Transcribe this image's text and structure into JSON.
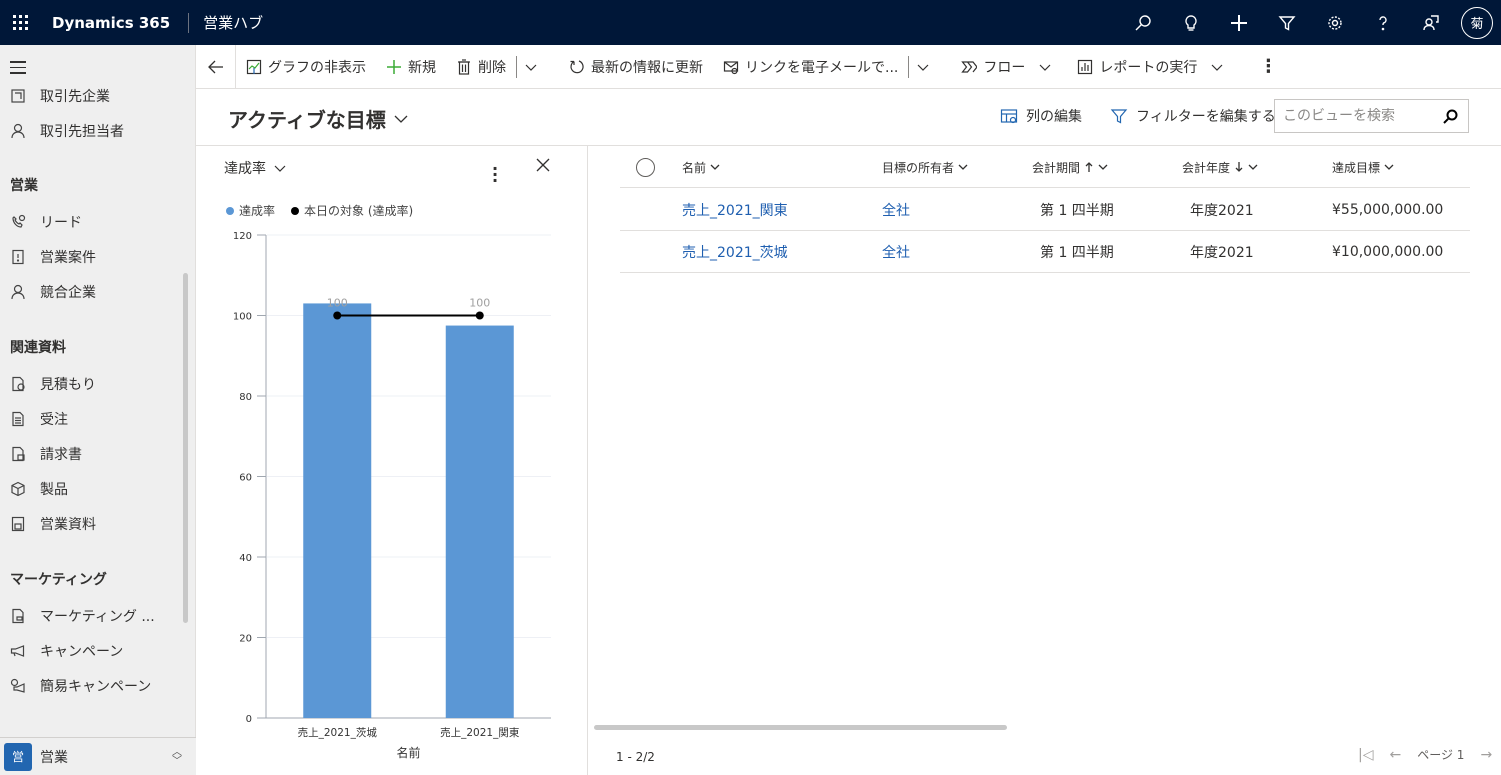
{
  "topbar": {
    "brand": "Dynamics 365",
    "app_name": "営業ハブ",
    "avatar_initial": "菊",
    "icons": [
      "search-icon",
      "lightbulb-icon",
      "plus-icon",
      "filter-icon",
      "gear-icon",
      "help-icon",
      "feedback-icon"
    ]
  },
  "sidebar": {
    "items_top": [
      {
        "label": "取引先企業",
        "icon": "account-icon"
      },
      {
        "label": "取引先担当者",
        "icon": "contact-icon"
      }
    ],
    "groups": [
      {
        "title": "営業",
        "items": [
          {
            "label": "リード",
            "icon": "lead-icon"
          },
          {
            "label": "営業案件",
            "icon": "opportunity-icon"
          },
          {
            "label": "競合企業",
            "icon": "competitor-icon"
          }
        ]
      },
      {
        "title": "関連資料",
        "items": [
          {
            "label": "見積もり",
            "icon": "quote-icon"
          },
          {
            "label": "受注",
            "icon": "order-icon"
          },
          {
            "label": "請求書",
            "icon": "invoice-icon"
          },
          {
            "label": "製品",
            "icon": "product-icon"
          },
          {
            "label": "営業資料",
            "icon": "sales-literature-icon"
          }
        ]
      },
      {
        "title": "マーケティング",
        "items": [
          {
            "label": "マーケティング ...",
            "icon": "marketing-list-icon"
          },
          {
            "label": "キャンペーン",
            "icon": "campaign-icon"
          },
          {
            "label": "簡易キャンペーン",
            "icon": "quick-campaign-icon"
          }
        ]
      }
    ],
    "area": {
      "badge": "営",
      "label": "営業"
    }
  },
  "commandbar": {
    "hide_chart": "グラフの非表示",
    "new": "新規",
    "delete": "削除",
    "refresh": "最新の情報に更新",
    "email_link": "リンクを電子メールで...",
    "flow": "フロー",
    "run_report": "レポートの実行"
  },
  "view": {
    "title": "アクティブな目標",
    "edit_columns": "列の編集",
    "edit_filters": "フィルターを編集する",
    "search_placeholder": "このビューを検索"
  },
  "chart_panel": {
    "title": "達成率",
    "legend": [
      {
        "label": "達成率",
        "color": "#5b97d5"
      },
      {
        "label": "本日の対象 (達成率)",
        "color": "#000000"
      }
    ]
  },
  "chart_data": {
    "type": "bar",
    "title": "達成率",
    "xlabel": "名前",
    "ylabel": "",
    "categories": [
      "売上_2021_茨城",
      "売上_2021_関東"
    ],
    "series": [
      {
        "name": "達成率",
        "type": "bar",
        "color": "#5b97d5",
        "values": [
          103,
          97.5
        ]
      },
      {
        "name": "本日の対象 (達成率)",
        "type": "line",
        "color": "#000000",
        "values": [
          100,
          100
        ],
        "data_labels": [
          "100",
          "100"
        ]
      }
    ],
    "ylim": [
      0,
      120
    ],
    "yticks": [
      0,
      20,
      40,
      60,
      80,
      100,
      120
    ],
    "grid": true,
    "legend": "top-left"
  },
  "grid": {
    "columns": [
      {
        "label": "名前",
        "sort": ""
      },
      {
        "label": "目標の所有者",
        "sort": ""
      },
      {
        "label": "会計期間",
        "sort": "asc"
      },
      {
        "label": "会計年度",
        "sort": "desc"
      },
      {
        "label": "達成目標",
        "sort": ""
      }
    ],
    "rows": [
      {
        "name": "売上_2021_関東",
        "owner": "全社",
        "period": "第 1 四半期",
        "year": "年度2021",
        "target": "¥55,000,000.00"
      },
      {
        "name": "売上_2021_茨城",
        "owner": "全社",
        "period": "第 1 四半期",
        "year": "年度2021",
        "target": "¥10,000,000.00"
      }
    ],
    "footer_count": "1 - 2/2",
    "page_label": "ページ 1"
  }
}
